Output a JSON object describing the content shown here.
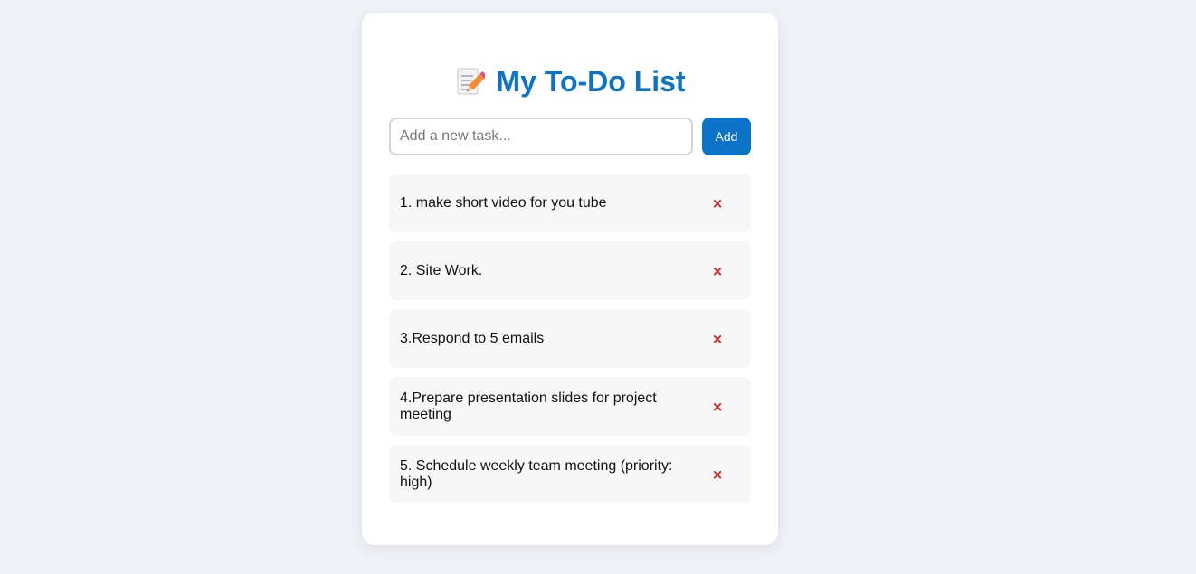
{
  "app": {
    "title": "My To-Do List",
    "title_icon": "memo-pencil-icon"
  },
  "colors": {
    "accent": "#0b74c8",
    "background": "#f0f2f7",
    "card": "#ffffff",
    "task_bg": "#f7f7f7",
    "delete": "#e01b1b"
  },
  "input": {
    "placeholder": "Add a new task...",
    "value": ""
  },
  "add_button": {
    "label": "Add"
  },
  "tasks": [
    {
      "text": "1. make short video for you tube",
      "delete_label": "×"
    },
    {
      "text": "2. Site Work.",
      "delete_label": "×"
    },
    {
      "text": "3.Respond to 5 emails",
      "delete_label": "×"
    },
    {
      "text": "4.Prepare presentation slides for project meeting",
      "delete_label": "×"
    },
    {
      "text": "5. Schedule weekly team meeting (priority: high)",
      "delete_label": "×"
    }
  ]
}
